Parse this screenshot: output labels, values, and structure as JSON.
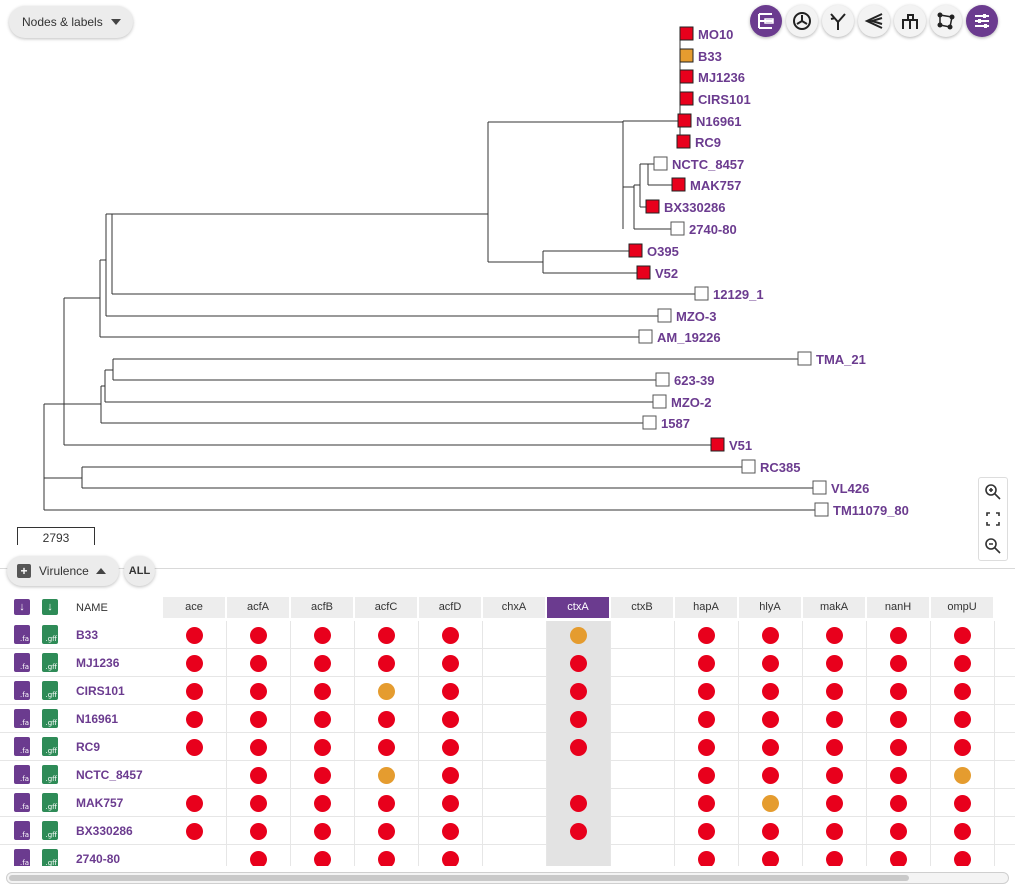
{
  "tree_panel": {
    "label_mode": "Nodes & labels",
    "scale_value": "2793",
    "toolbar_icons": [
      "rectangular-tree-icon",
      "circular-tree-icon",
      "unrooted-tree-icon",
      "radial-tree-icon",
      "diagonal-tree-icon",
      "network-tree-icon",
      "tree-settings-icon"
    ],
    "leaves": [
      {
        "label": "MO10",
        "color": "#e8001c"
      },
      {
        "label": "B33",
        "color": "#e59c2f"
      },
      {
        "label": "MJ1236",
        "color": "#e8001c"
      },
      {
        "label": "CIRS101",
        "color": "#e8001c"
      },
      {
        "label": "N16961",
        "color": "#e8001c"
      },
      {
        "label": "RC9",
        "color": "#e8001c"
      },
      {
        "label": "NCTC_8457",
        "color": "#ffffff"
      },
      {
        "label": "MAK757",
        "color": "#e8001c"
      },
      {
        "label": "BX330286",
        "color": "#e8001c"
      },
      {
        "label": "2740-80",
        "color": "#ffffff"
      },
      {
        "label": "O395",
        "color": "#e8001c"
      },
      {
        "label": "V52",
        "color": "#e8001c"
      },
      {
        "label": "12129_1",
        "color": "#ffffff"
      },
      {
        "label": "MZO-3",
        "color": "#ffffff"
      },
      {
        "label": "AM_19226",
        "color": "#ffffff"
      },
      {
        "label": "TMA_21",
        "color": "#ffffff"
      },
      {
        "label": "623-39",
        "color": "#ffffff"
      },
      {
        "label": "MZO-2",
        "color": "#ffffff"
      },
      {
        "label": "1587",
        "color": "#ffffff"
      },
      {
        "label": "V51",
        "color": "#e8001c"
      },
      {
        "label": "RC385",
        "color": "#ffffff"
      },
      {
        "label": "VL426",
        "color": "#ffffff"
      },
      {
        "label": "TM11079_80",
        "color": "#ffffff"
      }
    ]
  },
  "table_panel": {
    "timeline_name": "Virulence",
    "all_label": "ALL",
    "name_header": "NAME",
    "fa_label": ".fa",
    "gff_label": ".gff",
    "selected_column": "ctxA",
    "columns": [
      "ace",
      "acfA",
      "acfB",
      "acfC",
      "acfD",
      "chxA",
      "ctxA",
      "ctxB",
      "hapA",
      "hlyA",
      "makA",
      "nanH",
      "ompU"
    ],
    "colors": {
      "present": "#e8001c",
      "partial": "#e59c2f"
    },
    "rows": [
      {
        "name": "B33",
        "cells": [
          "R",
          "R",
          "R",
          "R",
          "R",
          "",
          "O",
          "",
          "R",
          "R",
          "R",
          "R",
          "R"
        ]
      },
      {
        "name": "MJ1236",
        "cells": [
          "R",
          "R",
          "R",
          "R",
          "R",
          "",
          "R",
          "",
          "R",
          "R",
          "R",
          "R",
          "R"
        ]
      },
      {
        "name": "CIRS101",
        "cells": [
          "R",
          "R",
          "R",
          "O",
          "R",
          "",
          "R",
          "",
          "R",
          "R",
          "R",
          "R",
          "R"
        ]
      },
      {
        "name": "N16961",
        "cells": [
          "R",
          "R",
          "R",
          "R",
          "R",
          "",
          "R",
          "",
          "R",
          "R",
          "R",
          "R",
          "R"
        ]
      },
      {
        "name": "RC9",
        "cells": [
          "R",
          "R",
          "R",
          "R",
          "R",
          "",
          "R",
          "",
          "R",
          "R",
          "R",
          "R",
          "R"
        ]
      },
      {
        "name": "NCTC_8457",
        "cells": [
          "",
          "R",
          "R",
          "O",
          "R",
          "",
          "",
          "",
          "R",
          "R",
          "R",
          "R",
          "O"
        ]
      },
      {
        "name": "MAK757",
        "cells": [
          "R",
          "R",
          "R",
          "R",
          "R",
          "",
          "R",
          "",
          "R",
          "O",
          "R",
          "R",
          "R"
        ]
      },
      {
        "name": "BX330286",
        "cells": [
          "R",
          "R",
          "R",
          "R",
          "R",
          "",
          "R",
          "",
          "R",
          "R",
          "R",
          "R",
          "R"
        ]
      },
      {
        "name": "2740-80",
        "cells": [
          "",
          "R",
          "R",
          "R",
          "R",
          "",
          "",
          "",
          "R",
          "R",
          "R",
          "R",
          "R"
        ]
      }
    ]
  }
}
